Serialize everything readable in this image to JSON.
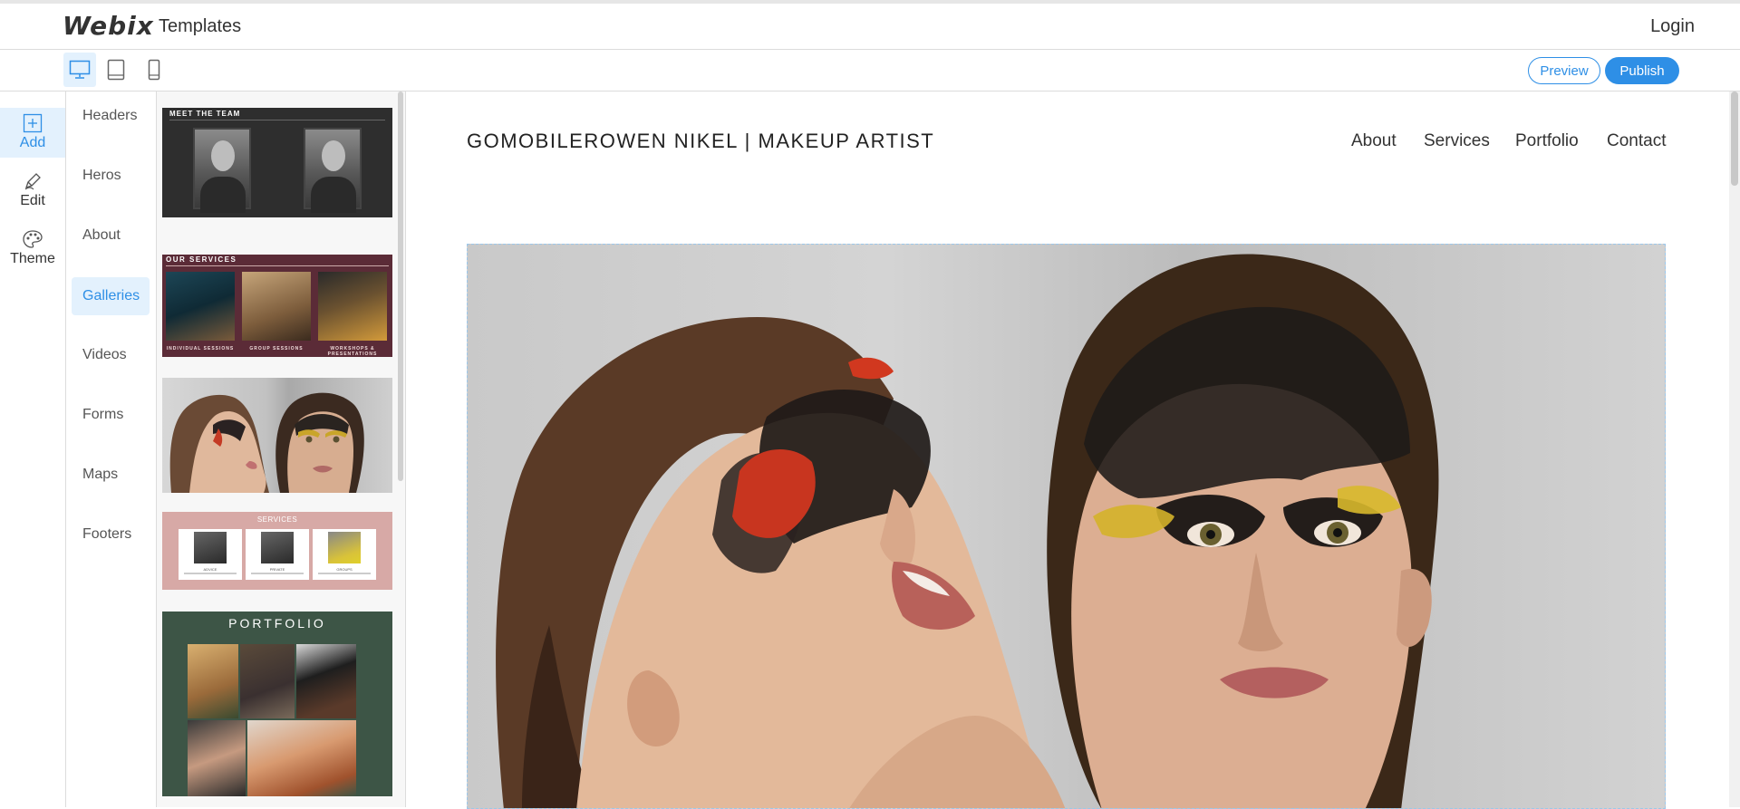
{
  "header": {
    "logo": "Webix",
    "title": "Templates",
    "login": "Login"
  },
  "toolbar": {
    "devices": [
      {
        "name": "desktop-view-icon",
        "active": true
      },
      {
        "name": "tablet-view-icon",
        "active": false
      },
      {
        "name": "mobile-view-icon",
        "active": false
      }
    ],
    "preview_label": "Preview",
    "publish_label": "Publish",
    "accent_color": "#2e8fe6"
  },
  "modes": [
    {
      "label": "Add",
      "icon": "plus-square-icon",
      "active": true
    },
    {
      "label": "Edit",
      "icon": "pencil-icon",
      "active": false
    },
    {
      "label": "Theme",
      "icon": "palette-icon",
      "active": false
    }
  ],
  "categories": [
    {
      "label": "Headers",
      "active": false
    },
    {
      "label": "Heros",
      "active": false
    },
    {
      "label": "About",
      "active": false
    },
    {
      "label": "Galleries",
      "active": true
    },
    {
      "label": "Videos",
      "active": false
    },
    {
      "label": "Forms",
      "active": false
    },
    {
      "label": "Maps",
      "active": false
    },
    {
      "label": "Footers",
      "active": false
    }
  ],
  "thumbnails": {
    "team": {
      "heading": "MEET THE TEAM"
    },
    "services_dark": {
      "heading": "OUR SERVICES",
      "captions": [
        "INDIVIDUAL SESSIONS",
        "GROUP SESSIONS",
        "WORKSHOPS & PRESENTATIONS"
      ]
    },
    "services_pink": {
      "heading": "SERVICES",
      "cards": [
        "ADVICE",
        "PRIVATE",
        "GROUPS"
      ]
    },
    "portfolio": {
      "heading": "PORTFOLIO"
    }
  },
  "site": {
    "title": "GOMOBILEROWEN NIKEL | MAKEUP ARTIST",
    "nav": [
      "About",
      "Services",
      "Portfolio",
      "Contact"
    ]
  }
}
